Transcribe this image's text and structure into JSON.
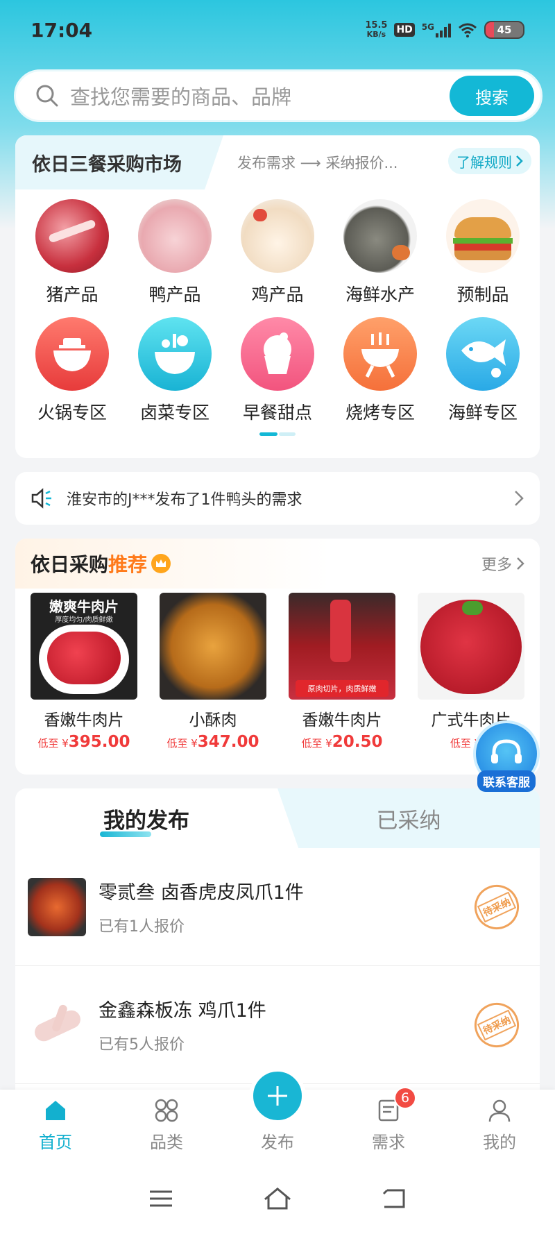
{
  "status_bar": {
    "time": "17:04",
    "speed_top": "15.5",
    "speed_bottom": "KB/s",
    "hd": "HD",
    "network": "5G",
    "battery": "45"
  },
  "search": {
    "placeholder": "查找您需要的商品、品牌",
    "button": "搜索"
  },
  "market": {
    "title": "依日三餐采购市场",
    "flow": "发布需求 ⟶ 采纳报价...",
    "rules_link": "了解规则",
    "categories": [
      {
        "label": "猪产品",
        "icon": "pork-icon"
      },
      {
        "label": "鸭产品",
        "icon": "duck-icon"
      },
      {
        "label": "鸡产品",
        "icon": "chicken-icon"
      },
      {
        "label": "海鲜水产",
        "icon": "seafood-icon"
      },
      {
        "label": "预制品",
        "icon": "burger-icon"
      },
      {
        "label": "火锅专区",
        "icon": "hotpot-icon"
      },
      {
        "label": "卤菜专区",
        "icon": "braised-icon"
      },
      {
        "label": "早餐甜点",
        "icon": "cupcake-icon"
      },
      {
        "label": "烧烤专区",
        "icon": "bbq-icon"
      },
      {
        "label": "海鲜专区",
        "icon": "fish-icon"
      }
    ]
  },
  "notice": {
    "text": "淮安市的J***发布了1件鸭头的需求"
  },
  "recommend": {
    "title_a": "依日采购",
    "title_b": "推荐",
    "more": "更多",
    "products": [
      {
        "name": "香嫩牛肉片",
        "price_prefix": "低至 ¥",
        "price": "395.00",
        "img_title": "嫩爽牛肉片",
        "img_sub": "厚度均匀/肉质鲜嫩"
      },
      {
        "name": "小酥肉",
        "price_prefix": "低至 ¥",
        "price": "347.00"
      },
      {
        "name": "香嫩牛肉片",
        "price_prefix": "低至 ¥",
        "price": "20.50",
        "img_sub": "原肉切片，肉质鲜嫩"
      },
      {
        "name": "广式牛肉片",
        "price_prefix": "低至 ¥",
        "price": "2"
      }
    ]
  },
  "support": {
    "label": "联系客服"
  },
  "my_posts": {
    "tab_active": "我的发布",
    "tab_inactive": "已采纳",
    "items": [
      {
        "title": "零贰叁 卤香虎皮凤爪1件",
        "sub": "已有1人报价",
        "stamp": "待采纳"
      },
      {
        "title": "金鑫森板冻 鸡爪1件",
        "sub": "已有5人报价",
        "stamp": "待采纳"
      }
    ]
  },
  "tabbar": {
    "home": "首页",
    "category": "品类",
    "publish": "发布",
    "demand": "需求",
    "demand_badge": "6",
    "mine": "我的"
  },
  "colors": {
    "accent": "#13b8d6",
    "price": "#f03a3a",
    "highlight": "#ff7a1a"
  }
}
